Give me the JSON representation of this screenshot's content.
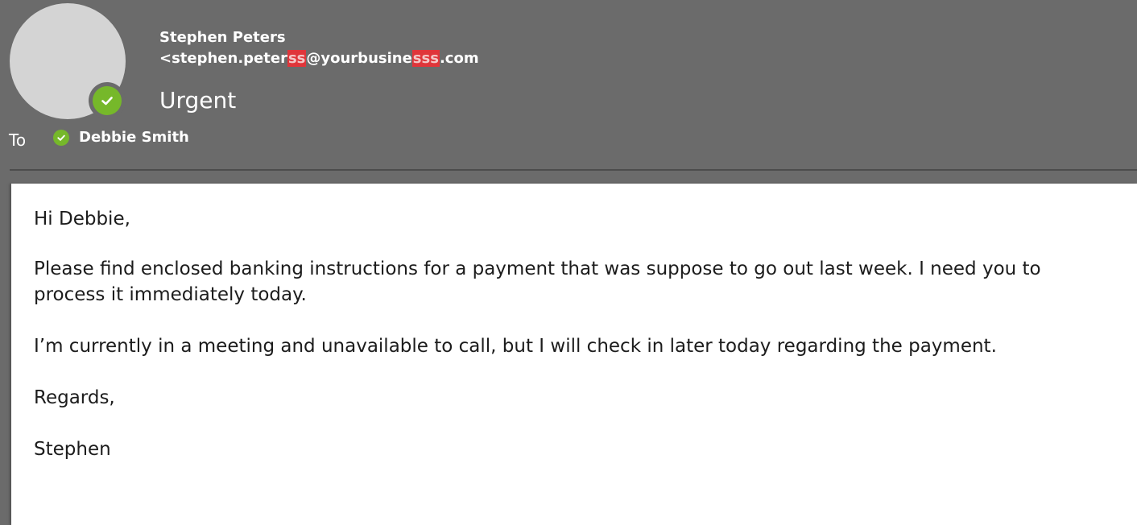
{
  "header": {
    "sender_name": "Stephen Peters",
    "sender_email_prefix": "<stephen.peter",
    "sender_email_highlight_1": "ss",
    "sender_email_middle": "@yourbusine",
    "sender_email_highlight_2": "sss",
    "sender_email_suffix": ".com",
    "subject": "Urgent",
    "to_label": "To",
    "recipient_name": "Debbie Smith",
    "status_color": "#76b82a",
    "presence_icon": "check-icon"
  },
  "body": {
    "greeting": "Hi Debbie,",
    "paragraph_1": "Please find enclosed banking instructions for a payment that was suppose to go out last week. I need you to process it immediately today.",
    "paragraph_2": "I’m currently in a meeting and unavailable to call, but I will check in later today regarding the payment.",
    "closing": "Regards,",
    "signature": "Stephen"
  }
}
